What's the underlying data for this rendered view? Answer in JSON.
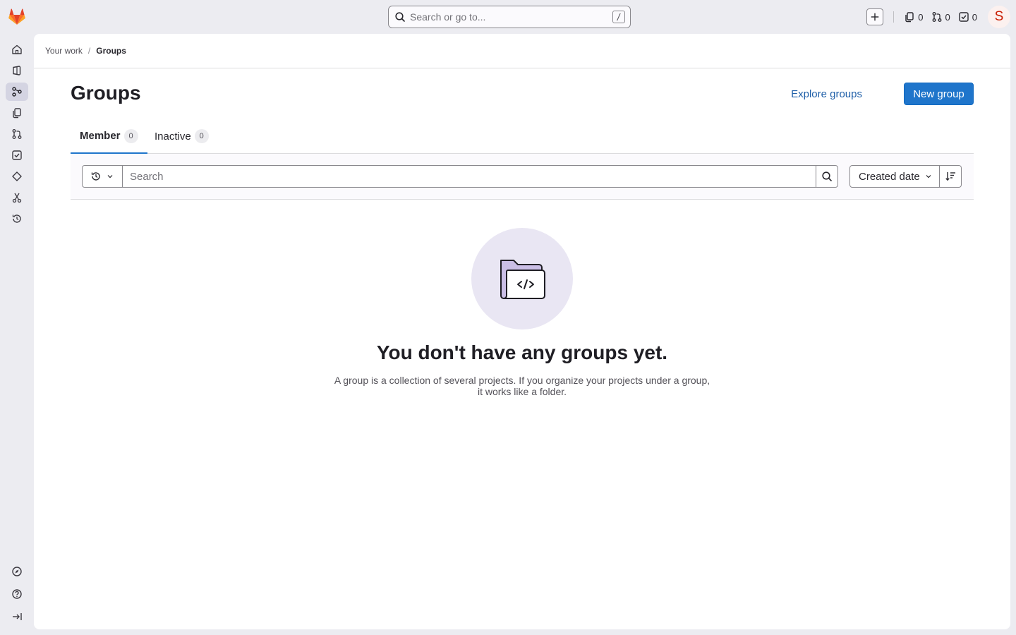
{
  "topbar": {
    "search_placeholder": "Search or go to...",
    "search_shortcut": "/",
    "issues_count": "0",
    "merge_requests_count": "0",
    "todos_count": "0",
    "avatar_initial": "S"
  },
  "sidebar": {
    "items": [
      {
        "name": "home",
        "icon": "home-icon"
      },
      {
        "name": "projects",
        "icon": "project-icon"
      },
      {
        "name": "groups",
        "icon": "group-icon",
        "active": true
      },
      {
        "name": "issues",
        "icon": "issues-icon"
      },
      {
        "name": "merge-requests",
        "icon": "merge-request-icon"
      },
      {
        "name": "todos",
        "icon": "todo-icon"
      },
      {
        "name": "milestones",
        "icon": "milestone-icon"
      },
      {
        "name": "snippets",
        "icon": "snippet-icon"
      },
      {
        "name": "activity",
        "icon": "history-icon"
      }
    ],
    "footer": [
      {
        "name": "explore",
        "icon": "compass-icon"
      },
      {
        "name": "help",
        "icon": "help-icon"
      },
      {
        "name": "collapse",
        "icon": "collapse-sidebar-icon"
      }
    ]
  },
  "breadcrumb": {
    "parent": "Your work",
    "separator": "/",
    "current": "Groups"
  },
  "page": {
    "title": "Groups",
    "explore_label": "Explore groups",
    "new_group_label": "New group"
  },
  "tabs": [
    {
      "label": "Member",
      "count": "0",
      "active": true
    },
    {
      "label": "Inactive",
      "count": "0",
      "active": false
    }
  ],
  "filter": {
    "search_placeholder": "Search",
    "sort_label": "Created date"
  },
  "empty_state": {
    "title": "You don't have any groups yet.",
    "description": "A group is a collection of several projects. If you organize your projects under a group, it works like a folder."
  },
  "colors": {
    "accent": "#1f75cb",
    "background": "#ececf1",
    "avatar_text": "#c91c00"
  }
}
